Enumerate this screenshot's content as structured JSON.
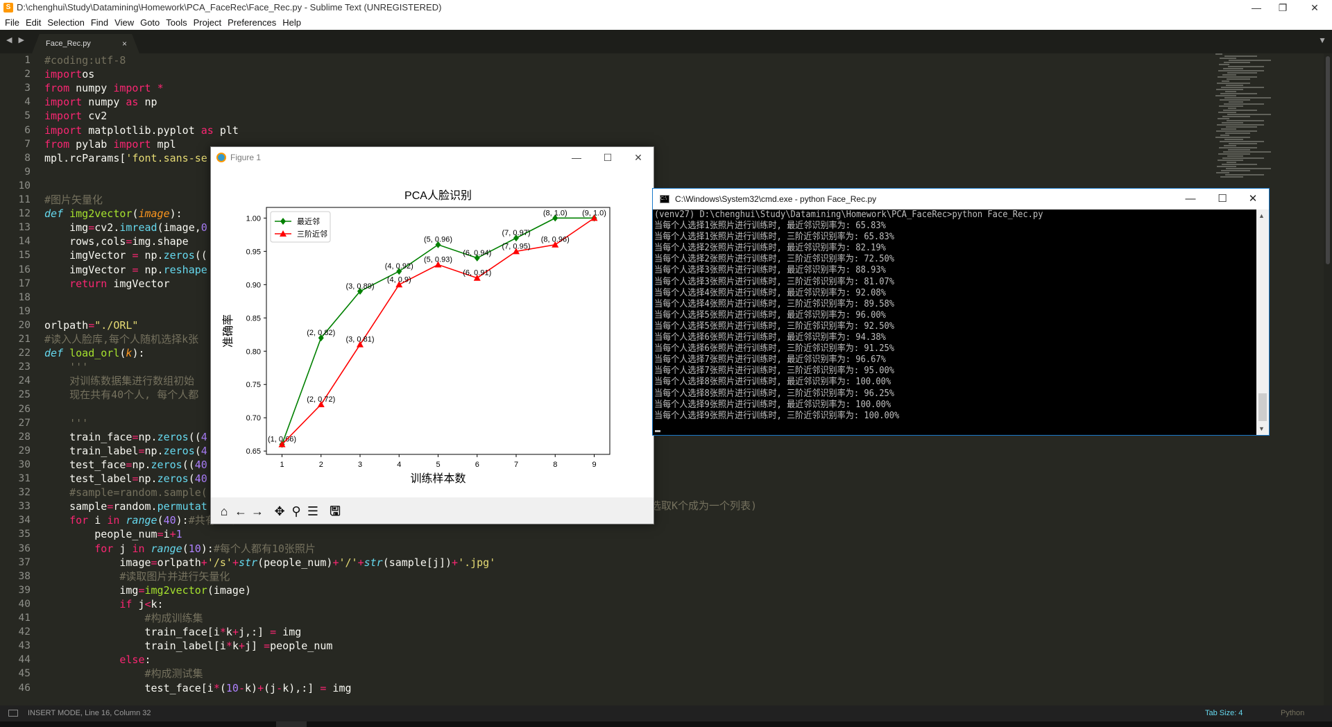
{
  "editor": {
    "title": "D:\\chenghui\\Study\\Datamining\\Homework\\PCA_FaceRec\\Face_Rec.py - Sublime Text (UNREGISTERED)",
    "app_icon_glyph": "S",
    "menu": [
      "File",
      "Edit",
      "Selection",
      "Find",
      "View",
      "Goto",
      "Tools",
      "Project",
      "Preferences",
      "Help"
    ],
    "tab": {
      "label": "Face_Rec.py",
      "close": "×"
    },
    "tab_nav": "◀ ▶",
    "tab_menu": "▼",
    "status_left": "INSERT MODE, Line 16, Column 32",
    "status_tab_size": "Tab Size: 4",
    "status_syntax": "Python",
    "window_buttons": {
      "min": "—",
      "max": "❐",
      "close": "✕"
    },
    "code_lines": [
      [
        [
          "c",
          "#coding:utf-8"
        ]
      ],
      [
        [
          "k",
          "import"
        ],
        [
          "",
          "os"
        ]
      ],
      [
        [
          "k",
          "from"
        ],
        [
          "",
          " numpy "
        ],
        [
          "k",
          "import"
        ],
        [
          "",
          " "
        ],
        [
          "k",
          "*"
        ]
      ],
      [
        [
          "k",
          "import"
        ],
        [
          "",
          " numpy "
        ],
        [
          "k",
          "as"
        ],
        [
          "",
          " np"
        ]
      ],
      [
        [
          "k",
          "import"
        ],
        [
          "",
          " cv2"
        ]
      ],
      [
        [
          "k",
          "import"
        ],
        [
          "",
          " matplotlib.pyplot "
        ],
        [
          "k",
          "as"
        ],
        [
          "",
          " plt"
        ]
      ],
      [
        [
          "k",
          "from"
        ],
        [
          "",
          " pylab "
        ],
        [
          "k",
          "import"
        ],
        [
          "",
          " mpl"
        ]
      ],
      [
        [
          "",
          "mpl.rcParams["
        ],
        [
          "s",
          "'font.sans-se"
        ]
      ],
      [],
      [],
      [
        [
          "c",
          "#图片矢量化"
        ]
      ],
      [
        [
          "bi",
          "def"
        ],
        [
          "",
          " "
        ],
        [
          "f",
          "img2vector"
        ],
        [
          "",
          "("
        ],
        [
          "p",
          "image"
        ],
        [
          "",
          "):"
        ]
      ],
      [
        [
          "",
          "    img"
        ],
        [
          "k",
          "="
        ],
        [
          "",
          "cv2."
        ],
        [
          "b",
          "imread"
        ],
        [
          "",
          "(image,"
        ],
        [
          "n",
          "0"
        ]
      ],
      [
        [
          "",
          "    rows,cols"
        ],
        [
          "k",
          "="
        ],
        [
          "",
          "img.shape"
        ]
      ],
      [
        [
          "",
          "    imgVector "
        ],
        [
          "k",
          "="
        ],
        [
          "",
          " np."
        ],
        [
          "b",
          "zeros"
        ],
        [
          "",
          "(("
        ]
      ],
      [
        [
          "",
          "    imgVector "
        ],
        [
          "k",
          "="
        ],
        [
          "",
          " np."
        ],
        [
          "b",
          "reshape"
        ]
      ],
      [
        [
          "",
          "    "
        ],
        [
          "k",
          "return"
        ],
        [
          "",
          " imgVector"
        ]
      ],
      [],
      [],
      [
        [
          "",
          "orlpath"
        ],
        [
          "k",
          "="
        ],
        [
          "s",
          "\"./ORL\""
        ]
      ],
      [
        [
          "c",
          "#读入人脸库,每个人随机选择k张"
        ]
      ],
      [
        [
          "bi",
          "def"
        ],
        [
          "",
          " "
        ],
        [
          "f",
          "load_orl"
        ],
        [
          "",
          "("
        ],
        [
          "p",
          "k"
        ],
        [
          "",
          "):"
        ]
      ],
      [
        [
          "",
          "    "
        ],
        [
          "c",
          "'''"
        ]
      ],
      [
        [
          "",
          "    "
        ],
        [
          "c",
          "对训练数据集进行数组初始"
        ]
      ],
      [
        [
          "",
          "    "
        ],
        [
          "c",
          "现在共有40个人, 每个人都"
        ]
      ],
      [],
      [
        [
          "",
          "    "
        ],
        [
          "c",
          "'''"
        ]
      ],
      [
        [
          "",
          "    train_face"
        ],
        [
          "k",
          "="
        ],
        [
          "",
          "np."
        ],
        [
          "b",
          "zeros"
        ],
        [
          "",
          "(("
        ],
        [
          "n",
          "4"
        ]
      ],
      [
        [
          "",
          "    train_label"
        ],
        [
          "k",
          "="
        ],
        [
          "",
          "np."
        ],
        [
          "b",
          "zeros"
        ],
        [
          "",
          "("
        ],
        [
          "n",
          "4"
        ]
      ],
      [
        [
          "",
          "    test_face"
        ],
        [
          "k",
          "="
        ],
        [
          "",
          "np."
        ],
        [
          "b",
          "zeros"
        ],
        [
          "",
          "(("
        ],
        [
          "n",
          "40"
        ]
      ],
      [
        [
          "",
          "    test_label"
        ],
        [
          "k",
          "="
        ],
        [
          "",
          "np."
        ],
        [
          "b",
          "zeros"
        ],
        [
          "",
          "("
        ],
        [
          "n",
          "40"
        ]
      ],
      [
        [
          "",
          "    "
        ],
        [
          "c",
          "#sample=random.sample("
        ]
      ],
      [
        [
          "",
          "    sample"
        ],
        [
          "k",
          "="
        ],
        [
          "",
          "random."
        ],
        [
          "b",
          "permutat"
        ]
      ],
      [
        [
          "",
          "    "
        ],
        [
          "k",
          "for"
        ],
        [
          "",
          " i "
        ],
        [
          "k",
          "in"
        ],
        [
          "",
          " "
        ],
        [
          "bi",
          "range"
        ],
        [
          "",
          "("
        ],
        [
          "n",
          "40"
        ],
        [
          "",
          "):"
        ],
        [
          "c",
          "#共有40个人"
        ]
      ],
      [
        [
          "",
          "        people_num"
        ],
        [
          "k",
          "="
        ],
        [
          "",
          "i"
        ],
        [
          "k",
          "+"
        ],
        [
          "n",
          "1"
        ]
      ],
      [
        [
          "",
          "        "
        ],
        [
          "k",
          "for"
        ],
        [
          "",
          " j "
        ],
        [
          "k",
          "in"
        ],
        [
          "",
          " "
        ],
        [
          "bi",
          "range"
        ],
        [
          "",
          "("
        ],
        [
          "n",
          "10"
        ],
        [
          "",
          "):"
        ],
        [
          "c",
          "#每个人都有10张照片"
        ]
      ],
      [
        [
          "",
          "            image"
        ],
        [
          "k",
          "="
        ],
        [
          "",
          "orlpath"
        ],
        [
          "k",
          "+"
        ],
        [
          "s",
          "'/s'"
        ],
        [
          "k",
          "+"
        ],
        [
          "bi",
          "str"
        ],
        [
          "",
          "(people_num)"
        ],
        [
          "k",
          "+"
        ],
        [
          "s",
          "'/'"
        ],
        [
          "k",
          "+"
        ],
        [
          "bi",
          "str"
        ],
        [
          "",
          "(sample[j])"
        ],
        [
          "k",
          "+"
        ],
        [
          "s",
          "'.jpg'"
        ]
      ],
      [
        [
          "",
          "            "
        ],
        [
          "c",
          "#读取图片并进行矢量化"
        ]
      ],
      [
        [
          "",
          "            img"
        ],
        [
          "k",
          "="
        ],
        [
          "f",
          "img2vector"
        ],
        [
          "",
          "(image)"
        ]
      ],
      [
        [
          "",
          "            "
        ],
        [
          "k",
          "if"
        ],
        [
          "",
          " j"
        ],
        [
          "k",
          "<"
        ],
        [
          "",
          "k:"
        ]
      ],
      [
        [
          "",
          "                "
        ],
        [
          "c",
          "#构成训练集"
        ]
      ],
      [
        [
          "",
          "                train_face[i"
        ],
        [
          "k",
          "*"
        ],
        [
          "",
          "k"
        ],
        [
          "k",
          "+"
        ],
        [
          "",
          "j,:] "
        ],
        [
          "k",
          "="
        ],
        [
          "",
          " img"
        ]
      ],
      [
        [
          "",
          "                train_label[i"
        ],
        [
          "k",
          "*"
        ],
        [
          "",
          "k"
        ],
        [
          "k",
          "+"
        ],
        [
          "",
          "j] "
        ],
        [
          "k",
          "="
        ],
        [
          "",
          "people_num"
        ]
      ],
      [
        [
          "",
          "            "
        ],
        [
          "k",
          "else"
        ],
        [
          "",
          ":"
        ]
      ],
      [
        [
          "",
          "                "
        ],
        [
          "c",
          "#构成测试集"
        ]
      ],
      [
        [
          "",
          "                test_face[i"
        ],
        [
          "k",
          "*"
        ],
        [
          "",
          "("
        ],
        [
          "n",
          "10"
        ],
        [
          "k",
          "-"
        ],
        [
          "",
          "k)"
        ],
        [
          "k",
          "+"
        ],
        [
          "",
          "(j"
        ],
        [
          "k",
          "-"
        ],
        [
          "",
          "k),:] "
        ],
        [
          "k",
          "="
        ],
        [
          "",
          " img"
        ]
      ]
    ],
    "hidden_comment_tail": "选取K个成为一个列表)"
  },
  "figure": {
    "title": "Figure 1",
    "window_buttons": {
      "min": "—",
      "max": "☐",
      "close": "✕"
    },
    "toolbar": [
      "home",
      "back",
      "forward",
      "pan",
      "zoom",
      "configure",
      "save"
    ],
    "toolbar_glyphs": {
      "home": "⌂",
      "back": "←",
      "forward": "→",
      "pan": "✥",
      "zoom": "⚲",
      "configure": "☰",
      "save": "🖫"
    }
  },
  "chart_data": {
    "type": "line",
    "title": "PCA人脸识别",
    "xlabel": "训练样本数",
    "ylabel": "准确率",
    "x": [
      1,
      2,
      3,
      4,
      5,
      6,
      7,
      8,
      9
    ],
    "xlim": [
      0.6,
      9.4
    ],
    "ylim": [
      0.645,
      1.016
    ],
    "xticks": [
      "1",
      "2",
      "3",
      "4",
      "5",
      "6",
      "7",
      "8",
      "9"
    ],
    "yticks": [
      "0.65",
      "0.70",
      "0.75",
      "0.80",
      "0.85",
      "0.90",
      "0.95",
      "1.00"
    ],
    "grid": false,
    "legend_position": "top-left",
    "series": [
      {
        "name": "最近邻",
        "color": "#008000",
        "marker": "diamond",
        "values": [
          0.66,
          0.82,
          0.89,
          0.92,
          0.96,
          0.94,
          0.97,
          1.0,
          1.0
        ],
        "labels": [
          "(1, 0.66)",
          "(2, 0.82)",
          "(3, 0.89)",
          "(4, 0.92)",
          "(5, 0.96)",
          "(6, 0.94)",
          "(7, 0.97)",
          "(8, 1.0)",
          "(9, 1.0)"
        ]
      },
      {
        "name": "三阶近邻",
        "color": "#ff0000",
        "marker": "triangle",
        "values": [
          0.66,
          0.72,
          0.81,
          0.9,
          0.93,
          0.91,
          0.95,
          0.96,
          1.0
        ],
        "labels": [
          "",
          "(2, 0.72)",
          "(3, 0.81)",
          "(4, 0.9)",
          "(5, 0.93)",
          "(6, 0.91)",
          "(7, 0.95)",
          "(8, 0.96)",
          ""
        ]
      }
    ]
  },
  "cmd": {
    "title": "C:\\Windows\\System32\\cmd.exe - python  Face_Rec.py",
    "window_buttons": {
      "min": "—",
      "max": "☐",
      "close": "✕"
    },
    "icon_text": "C:\\",
    "scroll_up": "▲",
    "scroll_down": "▼",
    "lines": [
      "(venv27) D:\\chenghui\\Study\\Datamining\\Homework\\PCA_FaceRec>python Face_Rec.py",
      "当每个人选择1张照片进行训练时, 最近邻识别率为: 65.83%",
      "当每个人选择1张照片进行训练时, 三阶近邻识别率为: 65.83%",
      "当每个人选择2张照片进行训练时, 最近邻识别率为: 82.19%",
      "当每个人选择2张照片进行训练时, 三阶近邻识别率为: 72.50%",
      "当每个人选择3张照片进行训练时, 最近邻识别率为: 88.93%",
      "当每个人选择3张照片进行训练时, 三阶近邻识别率为: 81.07%",
      "当每个人选择4张照片进行训练时, 最近邻识别率为: 92.08%",
      "当每个人选择4张照片进行训练时, 三阶近邻识别率为: 89.58%",
      "当每个人选择5张照片进行训练时, 最近邻识别率为: 96.00%",
      "当每个人选择5张照片进行训练时, 三阶近邻识别率为: 92.50%",
      "当每个人选择6张照片进行训练时, 最近邻识别率为: 94.38%",
      "当每个人选择6张照片进行训练时, 三阶近邻识别率为: 91.25%",
      "当每个人选择7张照片进行训练时, 最近邻识别率为: 96.67%",
      "当每个人选择7张照片进行训练时, 三阶近邻识别率为: 95.00%",
      "当每个人选择8张照片进行训练时, 最近邻识别率为: 100.00%",
      "当每个人选择8张照片进行训练时, 三阶近邻识别率为: 96.25%",
      "当每个人选择9张照片进行训练时, 最近邻识别率为: 100.00%",
      "当每个人选择9张照片进行训练时, 三阶近邻识别率为: 100.00%"
    ]
  }
}
